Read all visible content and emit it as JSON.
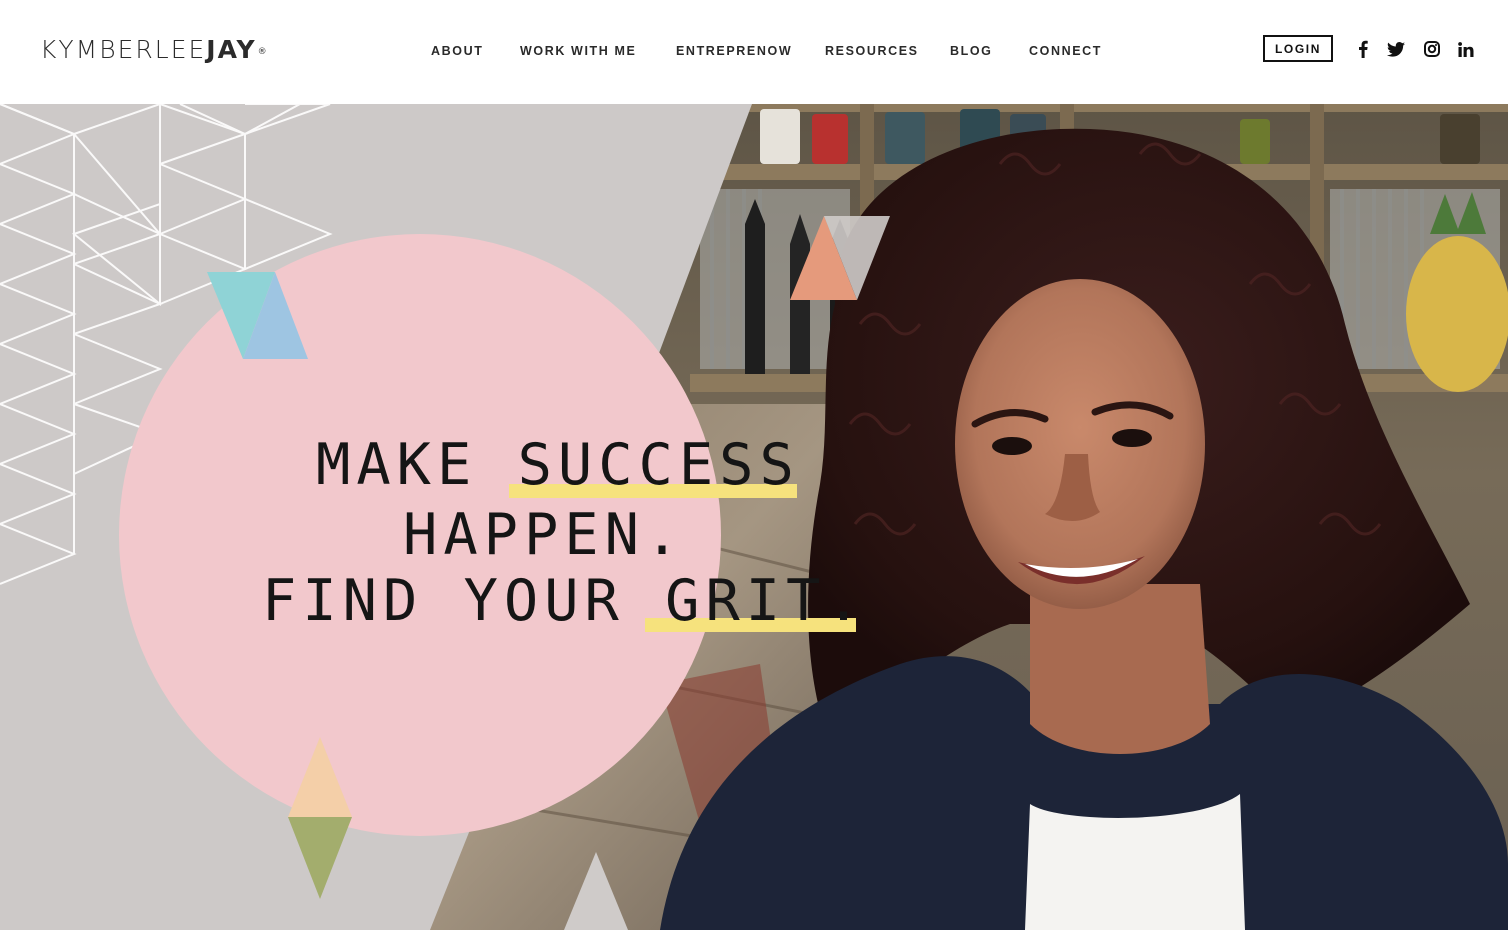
{
  "header": {
    "logo": {
      "part1": "KYMBERLEE",
      "part2": "JAY",
      "tm": "®"
    },
    "nav": [
      {
        "label": "ABOUT"
      },
      {
        "label": "WORK WITH ME"
      },
      {
        "label": "ENTREPRENOW"
      },
      {
        "label": "RESOURCES"
      },
      {
        "label": "BLOG"
      },
      {
        "label": "CONNECT"
      }
    ],
    "login_label": "LOGIN",
    "social": [
      "facebook-icon",
      "twitter-icon",
      "instagram-icon",
      "linkedin-icon"
    ]
  },
  "hero": {
    "headline": {
      "line1": "MAKE SUCCESS",
      "line2": "HAPPEN.",
      "line3": "FIND YOUR GRIT."
    },
    "colors": {
      "circle": "#f2c8cc",
      "highlight": "#f6e27d",
      "panel": "#cfcbc9",
      "teal": "#8fd3d6",
      "blue": "#9ec5e2",
      "coral": "#e59a7c",
      "peach": "#f4cfa8",
      "olive": "#a3ad6d"
    }
  }
}
